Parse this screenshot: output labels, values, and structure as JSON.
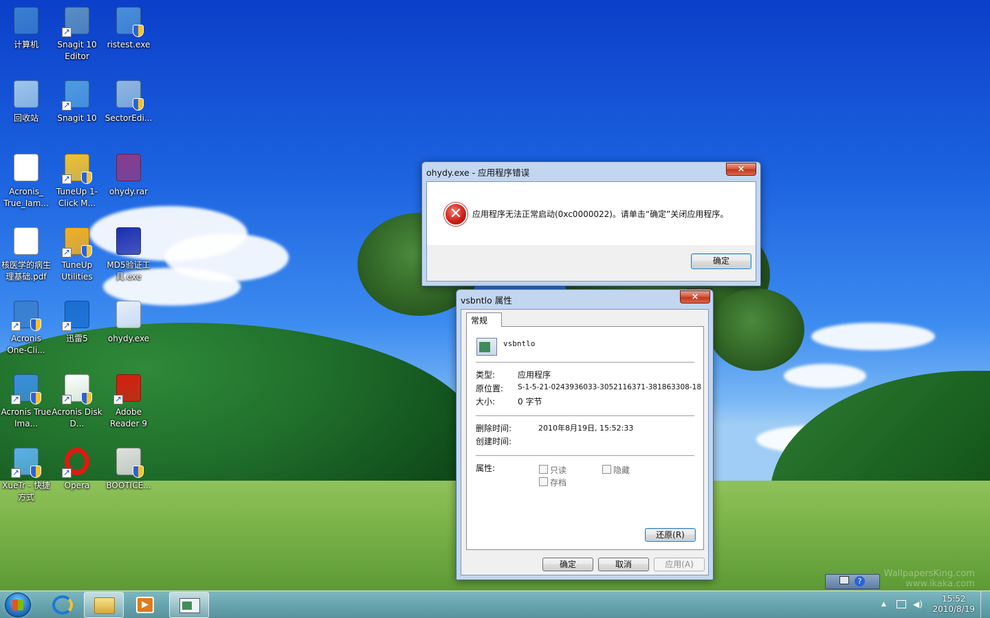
{
  "desktop": {
    "icons": [
      {
        "label": "计算机",
        "icon": "computer-icon"
      },
      {
        "label": "Snagit 10 Editor",
        "icon": "snagit-editor-icon"
      },
      {
        "label": "ristest.exe",
        "icon": "ristest-icon"
      },
      {
        "label": "回收站",
        "icon": "recycle-bin-icon"
      },
      {
        "label": "Snagit 10",
        "icon": "snagit-icon"
      },
      {
        "label": "SectorEdi...",
        "icon": "sectoredit-icon"
      },
      {
        "label": "Acronis_ True_Iam...",
        "icon": "pdf-icon"
      },
      {
        "label": "TuneUp 1-Click M...",
        "icon": "tuneup-icon"
      },
      {
        "label": "ohydy.rar",
        "icon": "winrar-icon"
      },
      {
        "label": "核医学的病生理基础.pdf",
        "icon": "pdf-icon"
      },
      {
        "label": "TuneUp Utilities",
        "icon": "tuneup-utilities-icon"
      },
      {
        "label": "MD5验证工具.exe",
        "icon": "md5-key-icon"
      },
      {
        "label": "Acronis One-Cli...",
        "icon": "acronis-icon"
      },
      {
        "label": "迅雷5",
        "icon": "thunder-icon"
      },
      {
        "label": "ohydy.exe",
        "icon": "exe-icon"
      },
      {
        "label": "Acronis True Ima...",
        "icon": "acronis-true-image-icon"
      },
      {
        "label": "Acronis Disk D...",
        "icon": "acronis-disk-icon"
      },
      {
        "label": "Adobe Reader 9",
        "icon": "adobe-reader-icon"
      },
      {
        "label": "XueTr - 快捷方式",
        "icon": "xuetr-icon"
      },
      {
        "label": "Opera",
        "icon": "opera-icon"
      },
      {
        "label": "BOOTICE...",
        "icon": "bootice-icon"
      }
    ],
    "watermark_line1": "WallpapersKing.com",
    "watermark_line2": "www.ikaka.com"
  },
  "error_dialog": {
    "title": "ohydy.exe - 应用程序错误",
    "close": "×",
    "message": "应用程序无法正常启动(0xc0000022)。请单击“确定”关闭应用程序。",
    "ok_label": "确定"
  },
  "props_dialog": {
    "title": "vsbntlo 属性",
    "close": "×",
    "tab": "常规",
    "file_name": "vsbntlo",
    "type_label": "类型:",
    "type_value": "应用程序",
    "location_label": "原位置:",
    "location_value": "S-1-5-21-0243936033-3052116371-381863308-18",
    "size_label": "大小:",
    "size_value": "0 字节",
    "deleted_label": "删除时间:",
    "deleted_value": "2010年8月19日, 15:52:33",
    "created_label": "创建时间:",
    "attributes_label": "属性:",
    "readonly_label": "只读",
    "hidden_label": "隐藏",
    "archive_label": "存档",
    "restore_label": "还原(R)",
    "ok_label": "确定",
    "cancel_label": "取消",
    "apply_label": "应用(A)"
  },
  "taskbar": {
    "time": "15:52",
    "date": "2010/8/19",
    "tray_arrow": "▲"
  }
}
